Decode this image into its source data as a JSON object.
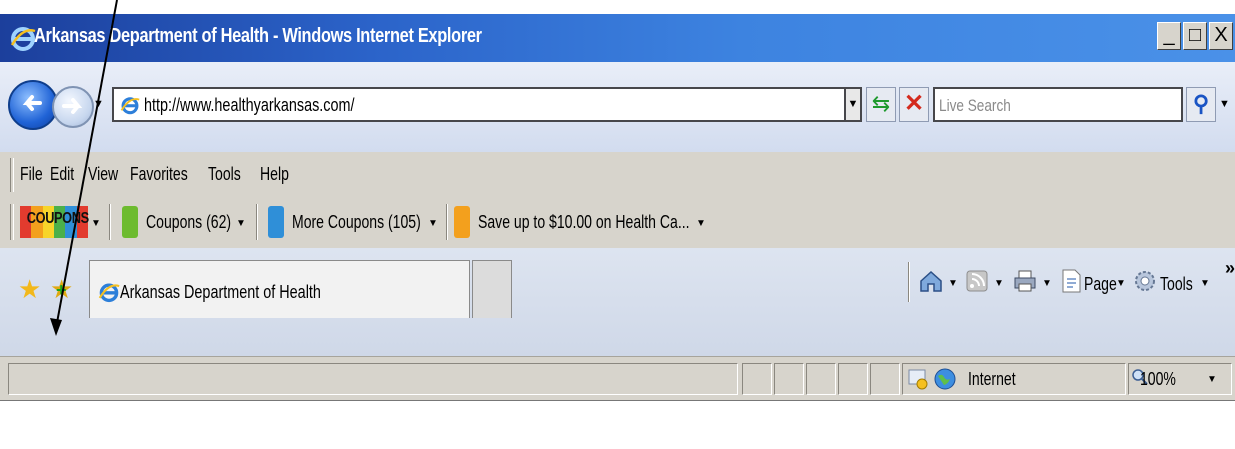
{
  "window": {
    "title": "Arkansas Department of Health - Windows Internet Explorer",
    "controls": [
      "_",
      "□",
      "X"
    ]
  },
  "address_bar": {
    "url": "http://www.healthyarkansas.com/",
    "search_placeholder": "Live Search"
  },
  "menu": {
    "items": [
      "File",
      "Edit",
      "View",
      "Favorites",
      "Tools",
      "Help"
    ]
  },
  "coupons_bar": {
    "logo": "COUPONS",
    "items": [
      "Coupons (62)",
      "More Coupons (105)",
      "Save up to $10.00 on Health Ca..."
    ]
  },
  "tabs": {
    "active_label": "Arkansas Department of Health"
  },
  "command_bar": {
    "page_label": "Page",
    "tools_label": "Tools",
    "overflow": "»"
  },
  "status_bar": {
    "zone": "Internet",
    "zoom": "100%"
  },
  "colors": {
    "title_bar": "#2b63c9",
    "chrome": "#d7d4cc",
    "nav_back": "#2063d6",
    "refresh": "#1f9a2e",
    "stop": "#d42a1d",
    "favorite_star": "#f2b81b"
  },
  "icons": [
    "ie-logo-icon",
    "back-arrow-icon",
    "forward-arrow-icon",
    "refresh-icon",
    "stop-icon",
    "search-icon",
    "favorites-star-icon",
    "add-favorites-icon",
    "home-icon",
    "feeds-icon",
    "print-icon",
    "page-icon",
    "tools-gear-icon",
    "zone-globe-icon",
    "zoom-icon",
    "protected-mode-icon"
  ]
}
